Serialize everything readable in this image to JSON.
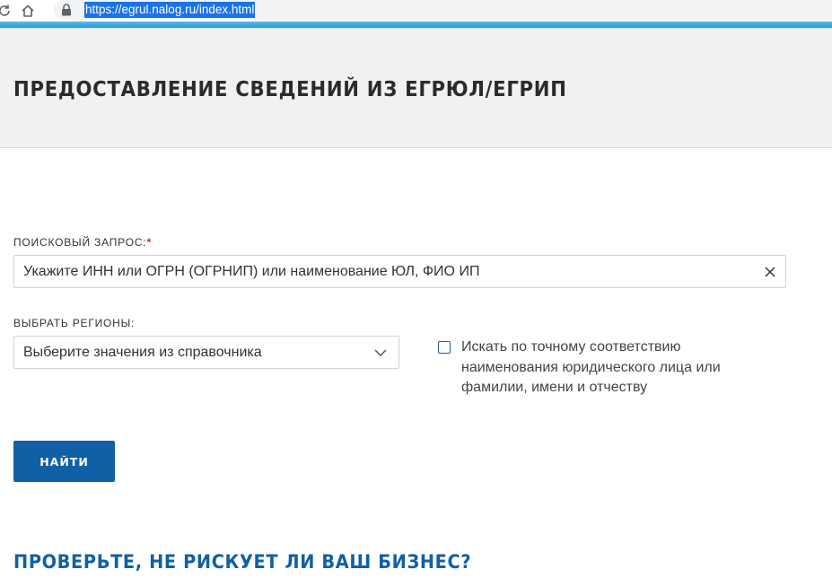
{
  "browser": {
    "url": "https://egrul.nalog.ru/index.html",
    "reload_icon": "reload-icon",
    "home_icon": "home-icon",
    "lock_icon": "lock-icon"
  },
  "header": {
    "title": "ПРЕДОСТАВЛЕНИЕ СВЕДЕНИЙ ИЗ ЕГРЮЛ/ЕГРИП"
  },
  "form": {
    "search_label": "ПОИСКОВЫЙ ЗАПРОС:",
    "required_mark": "*",
    "search_placeholder": "Укажите ИНН или ОГРН (ОГРНИП) или наименование ЮЛ, ФИО ИП",
    "search_value": "",
    "regions_label": "ВЫБРАТЬ РЕГИОНЫ:",
    "regions_placeholder": "Выберите значения из справочника",
    "exact_match_label": "Искать по точному соответствию наименования юридического лица или фамилии, имени и отчеству",
    "exact_match_checked": false,
    "submit_label": "НАЙТИ"
  },
  "promo": {
    "heading": "ПРОВЕРЬТЕ, НЕ РИСКУЕТ ЛИ ВАШ БИЗНЕС?"
  },
  "colors": {
    "accent": "#1060a6",
    "required": "#e21b1b",
    "header_bg": "#f1f1f1"
  }
}
